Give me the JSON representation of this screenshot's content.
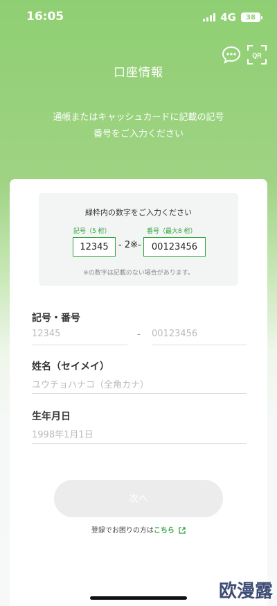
{
  "status": {
    "time": "16:05",
    "network": "4G",
    "battery": "38"
  },
  "header": {
    "title": "口座情報",
    "qr_label": "QR"
  },
  "subtitle_line1": "通帳またはキャッシュカードに記載の記号",
  "subtitle_line2": "番号をご入力ください",
  "info": {
    "title": "緑枠内の数字をご入力ください",
    "kigo_label": "記号（5 桁）",
    "bango_label": "番号（最大8 桁）",
    "kigo_value": "12345",
    "middle": "- 2※-",
    "bango_value": "00123456",
    "note": "※の数字は記載のない場合があります。"
  },
  "form": {
    "number_label": "記号・番号",
    "kigo_placeholder": "12345",
    "dash": "-",
    "bango_placeholder": "00123456",
    "name_label": "姓名（セイメイ）",
    "name_placeholder": "ユウチョハナコ（全角カナ）",
    "birth_label": "生年月日",
    "birth_placeholder": "1998年1月1日"
  },
  "next_button": "次へ",
  "help": {
    "text": "登録でお困りの方は",
    "link": "こちら"
  },
  "watermark": "欧漫露",
  "colors": {
    "accent": "#2fa23c",
    "header_green": "#8fcf73"
  }
}
